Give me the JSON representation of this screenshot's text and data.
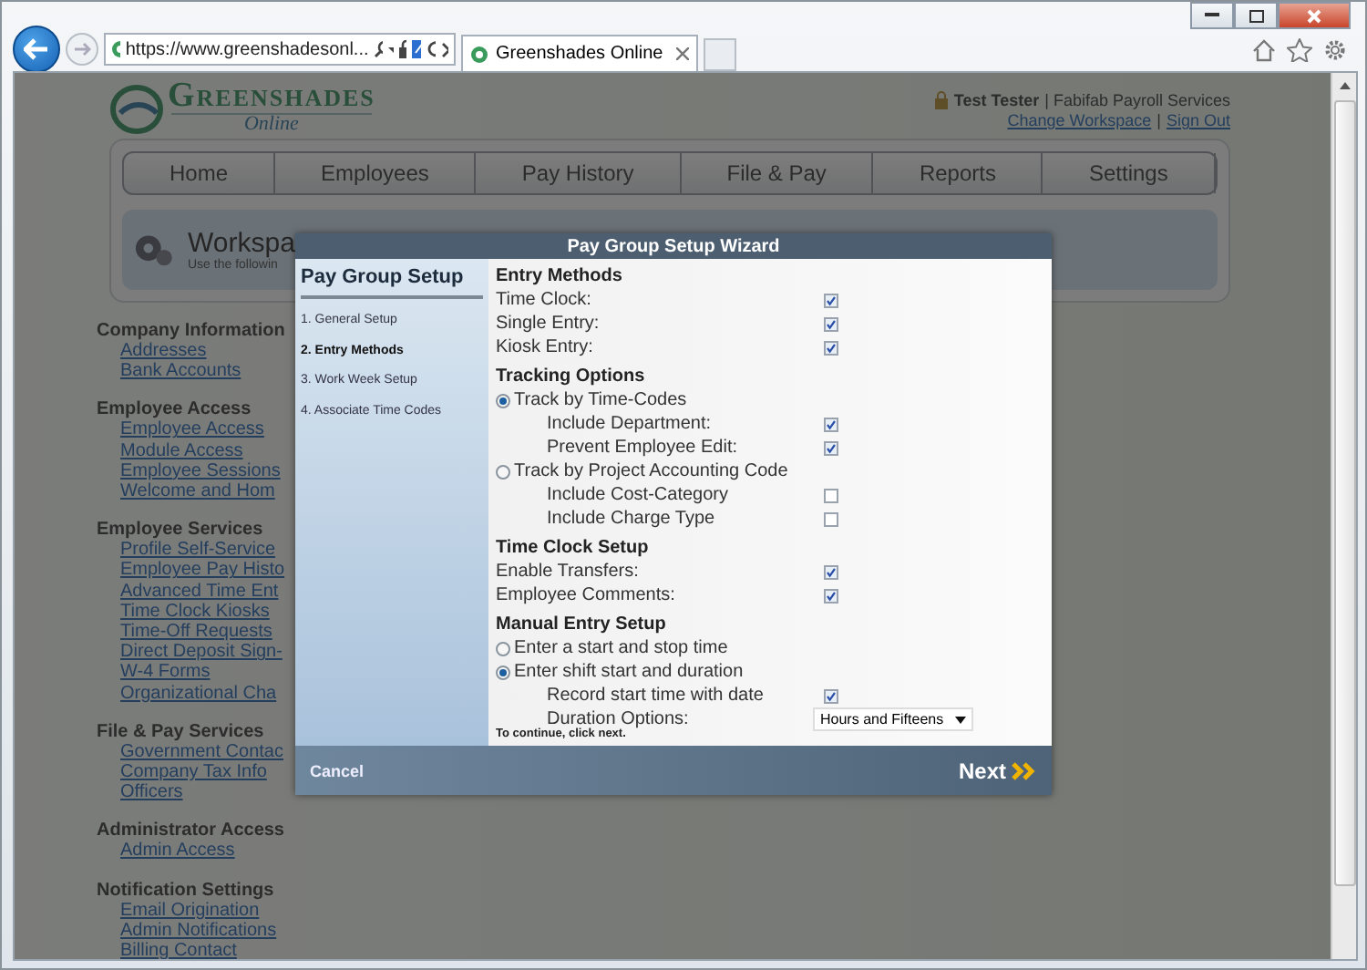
{
  "browser": {
    "address": "https://www.greenshadesonl...",
    "tabs": [
      {
        "title": "Greenshades Online",
        "selected": true
      }
    ]
  },
  "header": {
    "logo_name": "Greenshades",
    "logo_tagline": "Online",
    "user": "Test Tester",
    "company": "| Fabifab Payroll Services",
    "links": [
      "Change Workspace",
      "Sign Out"
    ],
    "link_separator": "|"
  },
  "nav": [
    "Home",
    "Employees",
    "Pay History",
    "File & Pay",
    "Reports",
    "Settings"
  ],
  "workspace": {
    "title": "Workspa",
    "subtitle": "Use the followin"
  },
  "sidebar": [
    {
      "title": "Company Information",
      "links": [
        "Addresses",
        "Bank Accounts"
      ]
    },
    {
      "title": "Employee Access",
      "links": [
        "Employee Access",
        "Module Access",
        "Employee Sessions",
        "Welcome and Hom"
      ]
    },
    {
      "title": "Employee Services",
      "links": [
        "Profile Self-Service",
        "Employee Pay Histo",
        "Advanced Time Ent",
        "Time Clock Kiosks",
        "Time-Off Requests",
        "Direct Deposit Sign-",
        "W-4 Forms",
        "Organizational Cha"
      ]
    },
    {
      "title": "File & Pay Services",
      "links": [
        "Government Contac",
        "Company Tax Info",
        "Officers"
      ]
    },
    {
      "title": "Administrator Access",
      "links": [
        "Admin Access"
      ]
    },
    {
      "title": "Notification Settings",
      "links": [
        "Email Origination",
        "Admin Notifications",
        "Billing Contact"
      ]
    }
  ],
  "wizard": {
    "title": "Pay Group Setup Wizard",
    "sidebar_title": "Pay Group Setup",
    "steps": [
      {
        "label": "1. General Setup",
        "selected": false
      },
      {
        "label": "2. Entry Methods",
        "selected": true
      },
      {
        "label": "3. Work Week Setup",
        "selected": false
      },
      {
        "label": "4. Associate Time Codes",
        "selected": false
      }
    ],
    "sections": [
      {
        "title": "Entry Methods",
        "rows": [
          {
            "kind": "check",
            "label": "Time Clock:",
            "checked": true
          },
          {
            "kind": "check",
            "label": "Single Entry:",
            "checked": true
          },
          {
            "kind": "check",
            "label": "Kiosk Entry:",
            "checked": true
          }
        ]
      },
      {
        "title": "Tracking Options",
        "rows": [
          {
            "kind": "radio",
            "label": "Track by Time-Codes",
            "selected": true,
            "children": [
              {
                "kind": "check",
                "label": "Include Department:",
                "checked": true
              },
              {
                "kind": "check",
                "label": "Prevent Employee Edit:",
                "checked": true
              }
            ]
          },
          {
            "kind": "radio",
            "label": "Track by Project Accounting Code",
            "selected": false,
            "children": [
              {
                "kind": "check",
                "label": "Include Cost-Category",
                "checked": false
              },
              {
                "kind": "check",
                "label": "Include Charge Type",
                "checked": false
              }
            ]
          }
        ]
      },
      {
        "title": "Time Clock Setup",
        "rows": [
          {
            "kind": "check",
            "label": "Enable Transfers:",
            "checked": true
          },
          {
            "kind": "check",
            "label": "Employee Comments:",
            "checked": true
          }
        ]
      },
      {
        "title": "Manual Entry Setup",
        "rows": [
          {
            "kind": "radio",
            "label": "Enter a start and stop time",
            "selected": false
          },
          {
            "kind": "radio",
            "label": "Enter shift start and duration",
            "selected": true,
            "children": [
              {
                "kind": "check",
                "label": "Record start time with date",
                "checked": true
              },
              {
                "kind": "select",
                "label": "Duration Options:",
                "value": "Hours and Fifteens"
              }
            ]
          }
        ]
      }
    ],
    "hint": "To continue, click next.",
    "cancel": "Cancel",
    "next": "Next"
  }
}
